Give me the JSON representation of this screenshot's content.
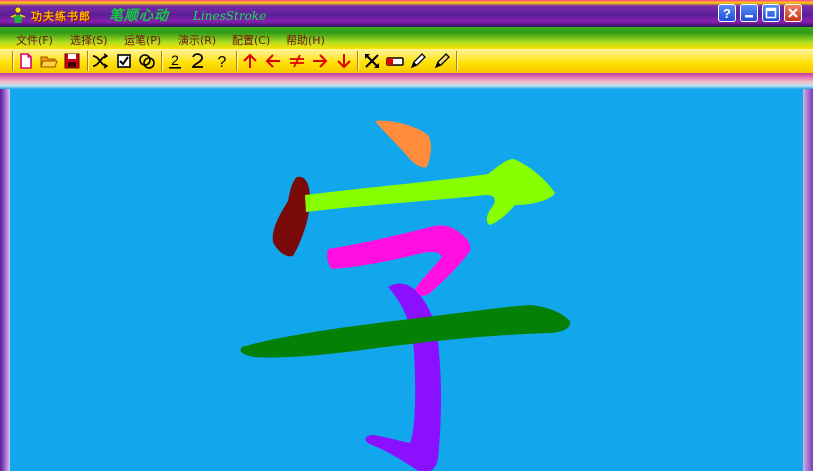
{
  "window": {
    "title_cn": "功夫练书郎",
    "subtitle_cn": "笔顺心动",
    "subtitle_en": "LinesStroke",
    "buttons": {
      "help": "?",
      "minimize": "minimize",
      "maximize": "maximize",
      "close": "close"
    }
  },
  "menu": {
    "items": [
      {
        "label": "文件(F)"
      },
      {
        "label": "选择(S)"
      },
      {
        "label": "运笔(P)"
      },
      {
        "label": "演示(R)"
      },
      {
        "label": "配置(C)"
      },
      {
        "label": "帮助(H)"
      }
    ]
  },
  "toolbar": {
    "buttons": [
      {
        "icon": "new-file-icon"
      },
      {
        "icon": "open-folder-icon"
      },
      {
        "icon": "save-disk-icon"
      },
      {
        "icon": "shuffle-icon"
      },
      {
        "icon": "checkbox-icon"
      },
      {
        "icon": "circles-icon"
      },
      {
        "icon": "number-2-underline-icon"
      },
      {
        "icon": "number-2-hook-icon"
      },
      {
        "icon": "question-icon"
      },
      {
        "icon": "arrow-up-icon"
      },
      {
        "icon": "arrow-left-icon"
      },
      {
        "icon": "not-equal-icon"
      },
      {
        "icon": "arrow-right-icon"
      },
      {
        "icon": "arrow-down-icon"
      },
      {
        "icon": "cross-arrows-icon"
      },
      {
        "icon": "eraser-icon"
      },
      {
        "icon": "pencil-icon"
      },
      {
        "icon": "pencil-alt-icon"
      }
    ]
  },
  "canvas": {
    "character": "字",
    "background": "#12a6ec",
    "stroke_colors": {
      "dot": "#ff8c3a",
      "left_dot": "#7a0a0a",
      "roof": "#88ff00",
      "hook_top": "#ff10e0",
      "vertical_hook": "#8a10ff",
      "horizontal": "#048004"
    }
  }
}
